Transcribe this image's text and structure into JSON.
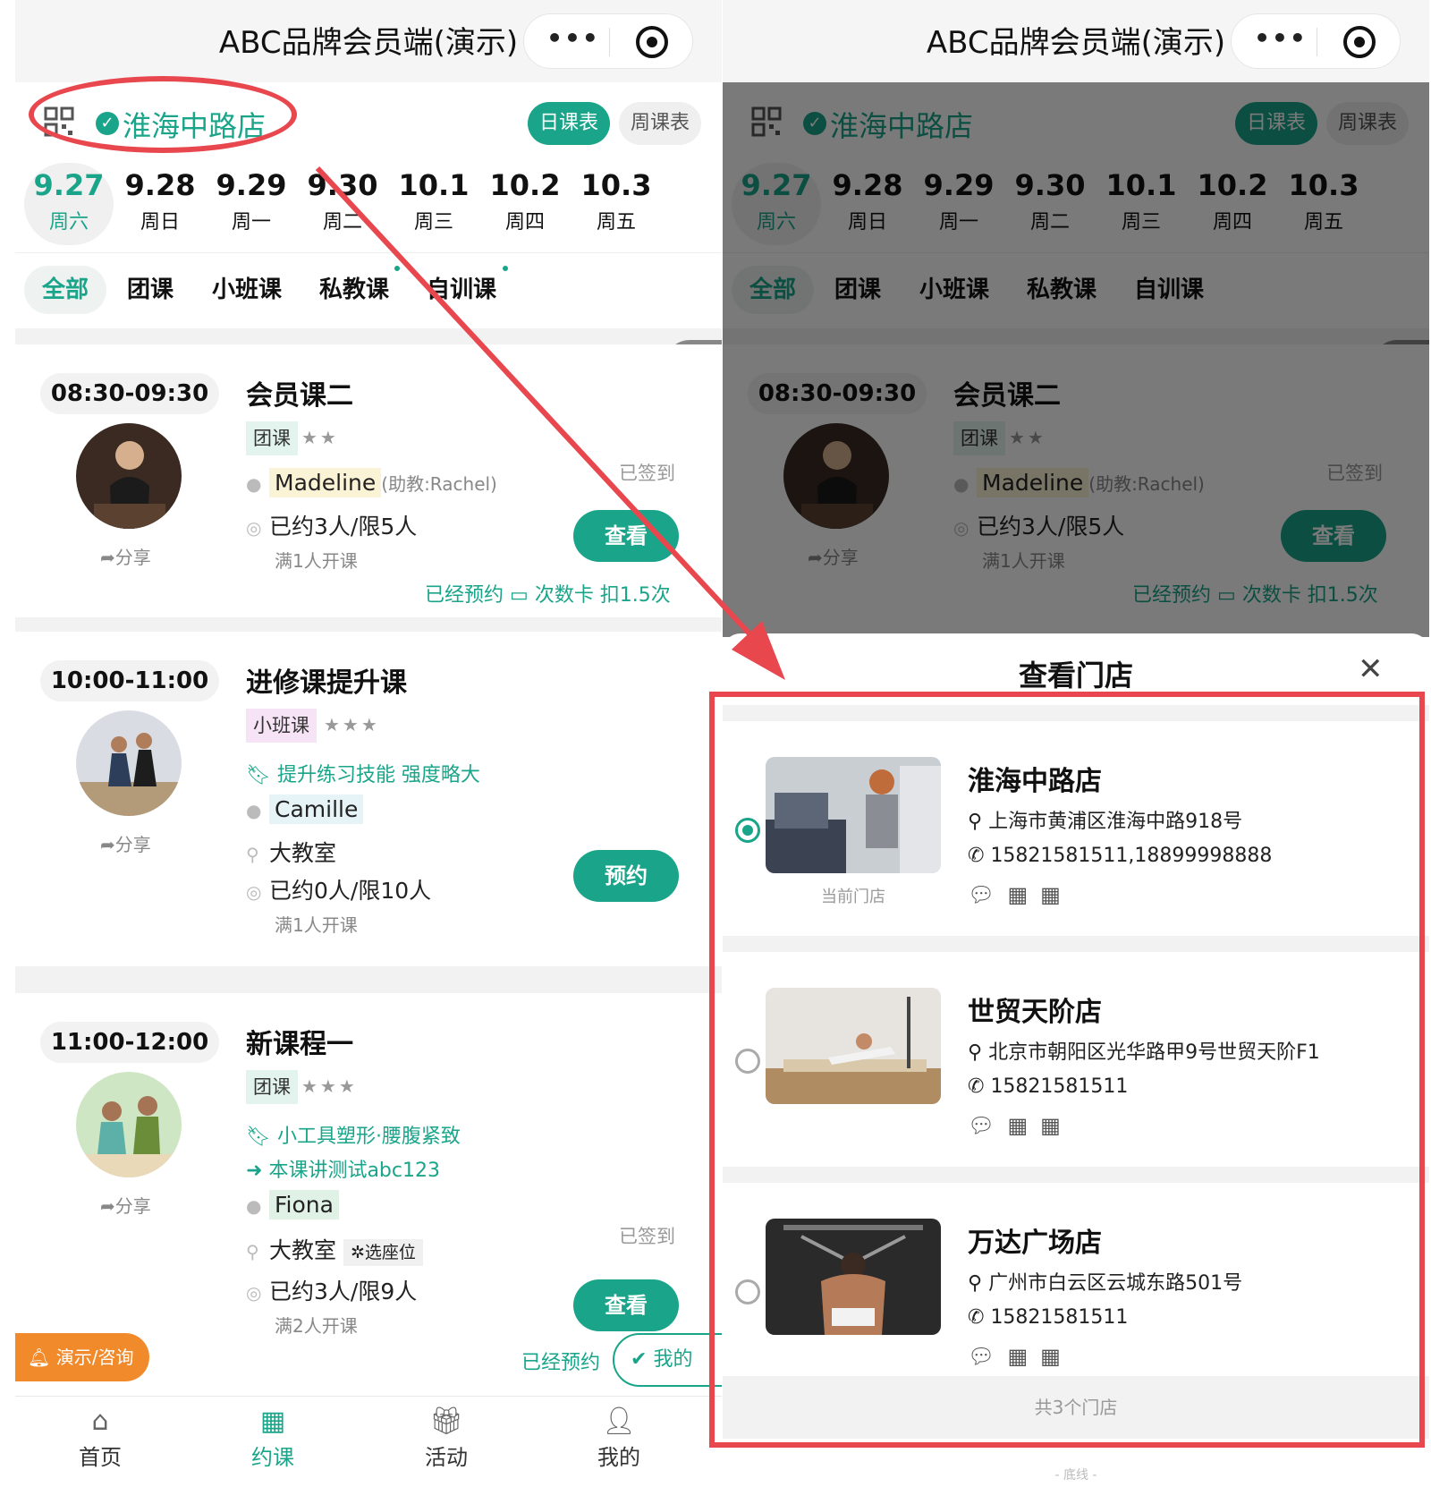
{
  "nav": {
    "title": "ABC品牌会员端(演示)",
    "more": "•••"
  },
  "store": {
    "name": "淮海中路店",
    "tab_day": "日课表",
    "tab_week": "周课表"
  },
  "dates": [
    {
      "num": "9.27",
      "week": "周六"
    },
    {
      "num": "9.28",
      "week": "周日"
    },
    {
      "num": "9.29",
      "week": "周一"
    },
    {
      "num": "9.30",
      "week": "周二"
    },
    {
      "num": "10.1",
      "week": "周三"
    },
    {
      "num": "10.2",
      "week": "周四"
    },
    {
      "num": "10.3",
      "week": "周五"
    }
  ],
  "categories": [
    "全部",
    "团课",
    "小班课",
    "私教课",
    "自训课"
  ],
  "courses": [
    {
      "time": "08:30-09:30",
      "title": "会员课二",
      "type": "团课",
      "stars": "★★",
      "share": "分享",
      "coach": "Madeline",
      "assistant": "(助教:Rachel)",
      "booked": "已约3人/限5人",
      "min": "满1人开课",
      "signed": "已签到",
      "button": "查看",
      "booking_note": "已经预约",
      "card_note": "次数卡 扣1.5次"
    },
    {
      "time": "10:00-11:00",
      "title": "进修课提升课",
      "type": "小班课",
      "stars": "★★★",
      "share": "分享",
      "tag1": "提升练习技能 强度略大",
      "coach": "Camille",
      "room": "大教室",
      "booked": "已约0人/限10人",
      "min": "满1人开课",
      "button": "预约"
    },
    {
      "time": "11:00-12:00",
      "title": "新课程一",
      "type": "团课",
      "stars": "★★★",
      "share": "分享",
      "tag1": "小工具塑形·腰腹紧致",
      "tag2": "本课讲测试abc123",
      "coach": "Fiona",
      "room": "大教室",
      "seat": "选座位",
      "booked": "已约3人/限9人",
      "min": "满2人开课",
      "signed": "已签到",
      "button": "查看",
      "booking_note": "已经预约"
    }
  ],
  "floating": {
    "demo": "演示/咨询",
    "mine": "我的"
  },
  "tabbar": [
    {
      "icon": "home-icon",
      "label": "首页"
    },
    {
      "icon": "calendar-grid-icon",
      "label": "约课"
    },
    {
      "icon": "gift-icon",
      "label": "活动"
    },
    {
      "icon": "user-icon",
      "label": "我的"
    }
  ],
  "sheet": {
    "title": "查看门店",
    "current_label": "当前门店",
    "stores": [
      {
        "name": "淮海中路店",
        "address": "上海市黄浦区淮海中路918号",
        "phone": "15821581511,18899998888"
      },
      {
        "name": "世贸天阶店",
        "address": "北京市朝阳区光华路甲9号世贸天阶F1",
        "phone": "15821581511"
      },
      {
        "name": "万达广场店",
        "address": "广州市白云区云城东路501号",
        "phone": "15821581511"
      }
    ],
    "footer": "共3个门店",
    "bottom_line": "- 底线 -"
  },
  "colors": {
    "accent": "#1aa58a",
    "annotation": "#e8474e",
    "demo": "#f08a2a"
  }
}
